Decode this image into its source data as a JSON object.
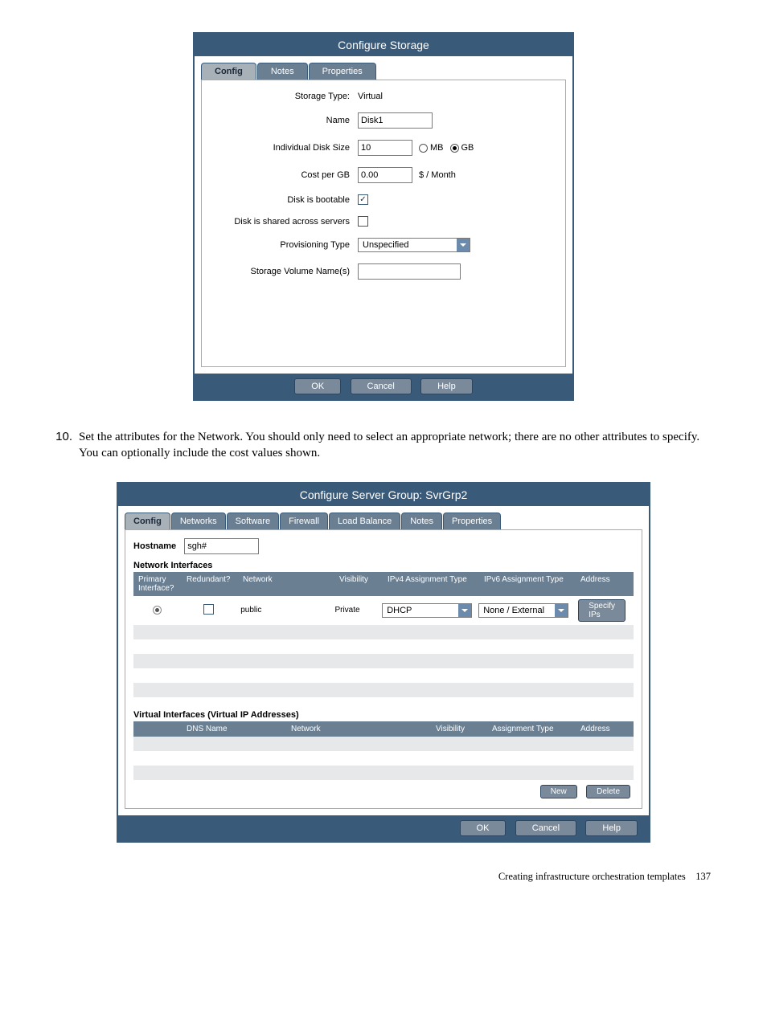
{
  "dialog1": {
    "title": "Configure Storage",
    "tabs": [
      "Config",
      "Notes",
      "Properties"
    ],
    "active_tab": 0,
    "fields": {
      "storage_type_label": "Storage Type:",
      "storage_type_value": "Virtual",
      "name_label": "Name",
      "name_value": "Disk1",
      "disk_size_label": "Individual Disk Size",
      "disk_size_value": "10",
      "unit_mb": "MB",
      "unit_gb": "GB",
      "cost_label": "Cost per GB",
      "cost_value": "0.00",
      "cost_suffix": "$ / Month",
      "bootable_label": "Disk is bootable",
      "shared_label": "Disk is shared across servers",
      "prov_label": "Provisioning Type",
      "prov_value": "Unspecified",
      "volume_label": "Storage Volume Name(s)",
      "volume_value": ""
    },
    "buttons": {
      "ok": "OK",
      "cancel": "Cancel",
      "help": "Help"
    }
  },
  "step": {
    "num": "10.",
    "text": "Set the attributes for the Network. You should only need to select an appropriate network; there are no other attributes to specify. You can optionally include the cost values shown."
  },
  "dialog2": {
    "title": "Configure Server Group: SvrGrp2",
    "tabs": [
      "Config",
      "Networks",
      "Software",
      "Firewall",
      "Load Balance",
      "Notes",
      "Properties"
    ],
    "active_tab": 0,
    "hostname_label": "Hostname",
    "hostname_value": "sgh#",
    "net_section": "Network Interfaces",
    "net_headers": [
      "Primary Interface?",
      "Redundant?",
      "Network",
      "Visibility",
      "IPv4 Assignment Type",
      "IPv6 Assignment Type",
      "Address"
    ],
    "net_row": {
      "network": "public",
      "visibility": "Private",
      "ipv4": "DHCP",
      "ipv6": "None / External",
      "address_btn": "Specify IPs"
    },
    "virt_section": "Virtual Interfaces (Virtual IP Addresses)",
    "virt_headers": [
      "",
      "DNS Name",
      "Network",
      "Visibility",
      "Assignment Type",
      "Address"
    ],
    "inner_buttons": {
      "new": "New",
      "delete": "Delete"
    },
    "buttons": {
      "ok": "OK",
      "cancel": "Cancel",
      "help": "Help"
    }
  },
  "footer": {
    "section": "Creating infrastructure orchestration templates",
    "page": "137"
  }
}
